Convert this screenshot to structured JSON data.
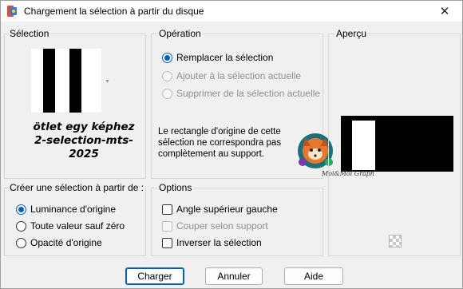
{
  "window": {
    "title": "Chargement la sélection à partir du disque",
    "close_glyph": "✕"
  },
  "selection": {
    "title": "Sélection",
    "caption": "ötlet egy képhez  2-selection-mts-2025",
    "thumbnail_icon": "black-white-stripes-thumbnail"
  },
  "operation": {
    "title": "Opération",
    "options": [
      {
        "label": "Remplacer la sélection",
        "checked": true,
        "enabled": true
      },
      {
        "label": "Ajouter à la sélection actuelle",
        "checked": false,
        "enabled": false
      },
      {
        "label": "Supprimer de la sélection actuelle",
        "checked": false,
        "enabled": false
      }
    ],
    "note": "Le rectangle d'origine de cette sélection ne correspondra pas complètement au support."
  },
  "preview": {
    "title": "Aperçu",
    "watermark_text": "Moi&Moi Graph"
  },
  "create_from": {
    "title": "Créer une sélection à partir de :",
    "options": [
      {
        "label": "Luminance d'origine",
        "checked": true
      },
      {
        "label": "Toute valeur sauf zéro",
        "checked": false
      },
      {
        "label": "Opacité d'origine",
        "checked": false
      }
    ]
  },
  "options": {
    "title": "Options",
    "checkboxes": [
      {
        "label": "Angle supérieur gauche",
        "checked": false,
        "enabled": true
      },
      {
        "label": "Couper selon support",
        "checked": false,
        "enabled": false
      },
      {
        "label": "Inverser la sélection",
        "checked": false,
        "enabled": true
      }
    ]
  },
  "buttons": {
    "load": "Charger",
    "cancel": "Annuler",
    "help": "Aide"
  },
  "colors": {
    "accent": "#005fb8",
    "disabled": "#8f8f8f",
    "background": "#f0f0f0"
  }
}
